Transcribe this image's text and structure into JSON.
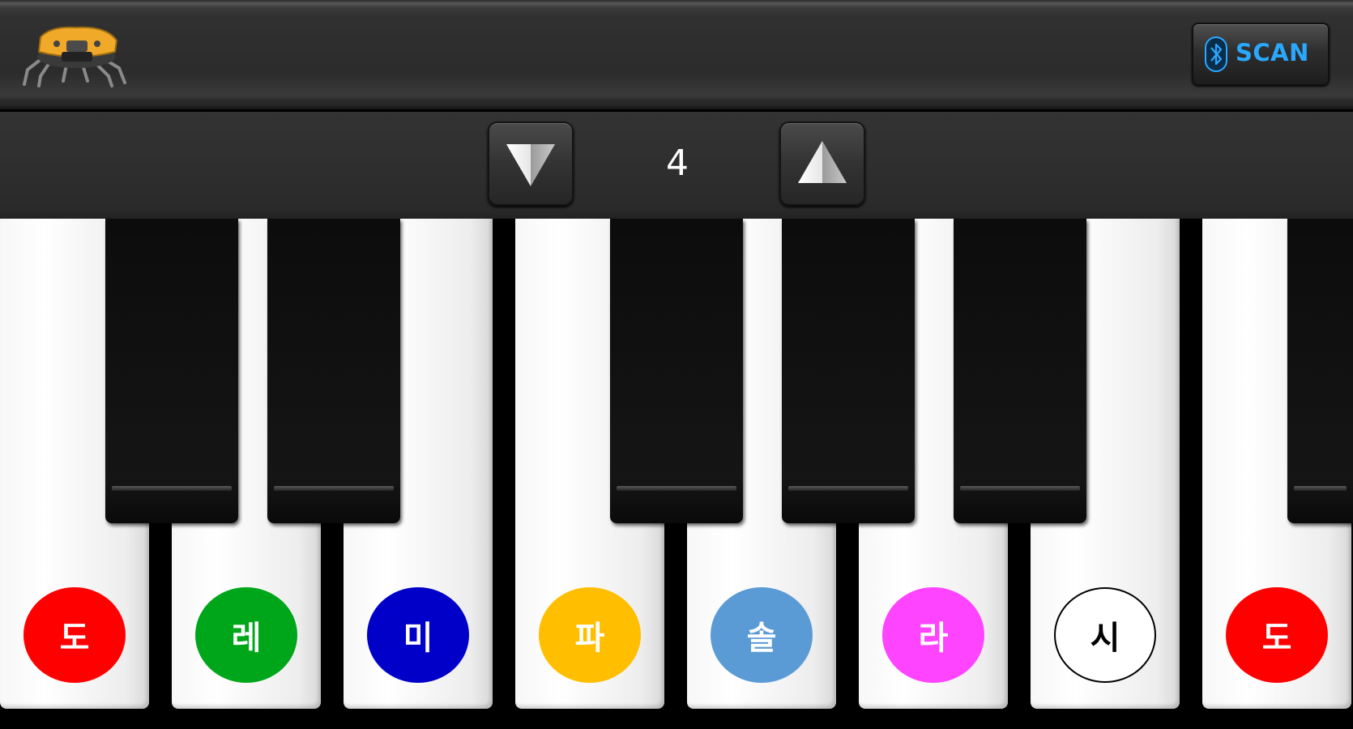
{
  "header": {
    "logo_icon": "robot-spider-logo",
    "scan_button": {
      "icon": "bluetooth-icon",
      "label": "SCAN",
      "color": "#2aa8ff"
    }
  },
  "octave": {
    "down_icon": "triangle-down-icon",
    "up_icon": "triangle-up-icon",
    "value": "4"
  },
  "keyboard": {
    "white_keys": [
      {
        "note": "도",
        "color": "#ff0000"
      },
      {
        "note": "레",
        "color": "#00a61a"
      },
      {
        "note": "미",
        "color": "#0000c8"
      },
      {
        "note": "파",
        "color": "#ffbf00"
      },
      {
        "note": "솔",
        "color": "#5b9bd5"
      },
      {
        "note": "라",
        "color": "#ff44ff"
      },
      {
        "note": "시",
        "color": "#ffffff"
      },
      {
        "note": "도",
        "color": "#ff0000"
      }
    ],
    "black_key_count": 6
  }
}
